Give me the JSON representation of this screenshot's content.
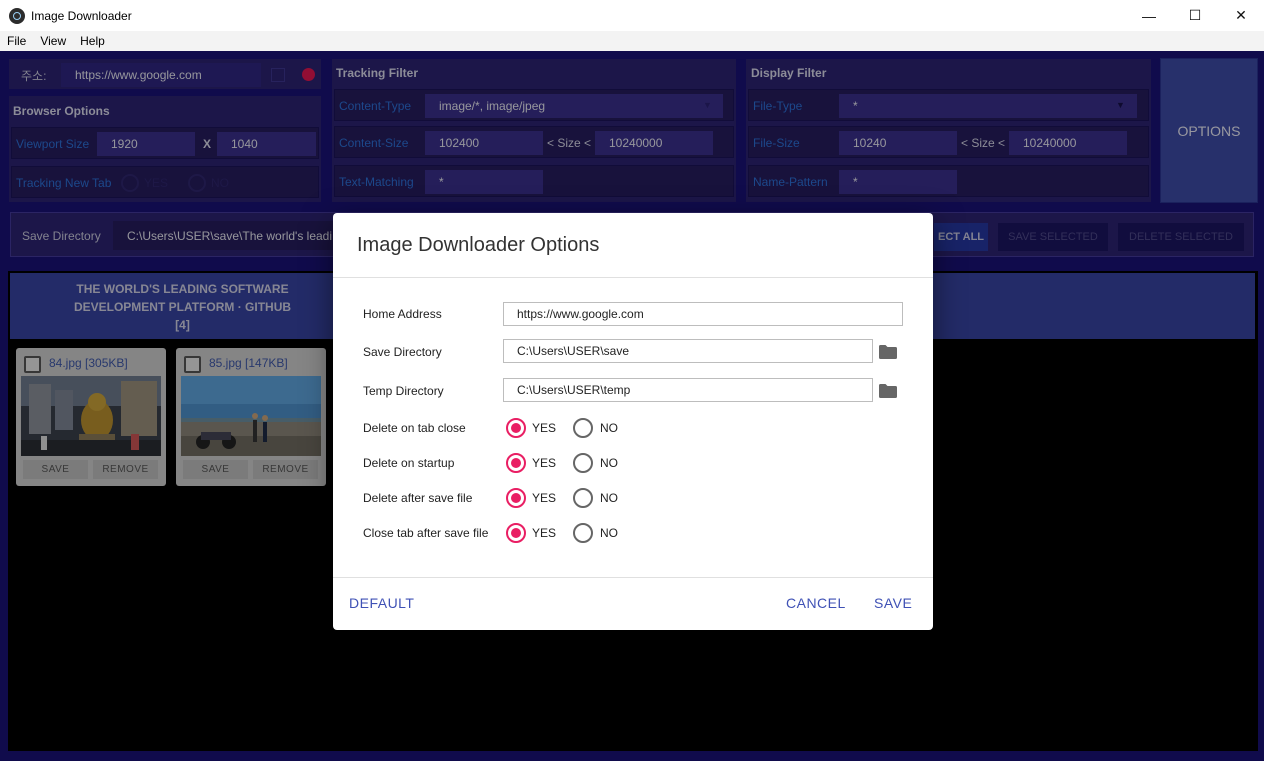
{
  "window": {
    "title": "Image Downloader",
    "minimize": "—",
    "maximize": "☐",
    "close": "✕"
  },
  "menu": [
    "File",
    "View",
    "Help"
  ],
  "address": {
    "label": "주소:",
    "value": "https://www.google.com"
  },
  "browser_options": {
    "title": "Browser Options",
    "viewport_label": "Viewport Size",
    "width": "1920",
    "x": "X",
    "height": "1040",
    "tracking_label": "Tracking New Tab",
    "yes": "YES",
    "no": "NO"
  },
  "tracking_filter": {
    "title": "Tracking Filter",
    "content_type_label": "Content-Type",
    "content_type_value": "image/*, image/jpeg",
    "content_size_label": "Content-Size",
    "size_min": "102400",
    "size_sep": "< Size <",
    "size_max": "10240000",
    "text_matching_label": "Text-Matching",
    "text_matching_value": "*"
  },
  "display_filter": {
    "title": "Display Filter",
    "file_type_label": "File-Type",
    "file_type_value": "*",
    "file_size_label": "File-Size",
    "size_min": "10240",
    "size_sep": "< Size <",
    "size_max": "10240000",
    "name_pattern_label": "Name-Pattern",
    "name_pattern_value": "*"
  },
  "options_button": "OPTIONS",
  "save_bar": {
    "label": "Save Directory",
    "value": "C:\\Users\\USER\\save\\The world's leadi",
    "select_all": "ECT ALL",
    "save_selected": "SAVE SELECTED",
    "delete_selected": "DELETE SELECTED"
  },
  "gallery": {
    "title_line1": "THE WORLD'S LEADING SOFTWARE",
    "title_line2": "DEVELOPMENT PLATFORM · GITHUB",
    "count": "[4]",
    "cards": [
      {
        "name": "84.jpg [305KB]",
        "save": "SAVE",
        "remove": "REMOVE"
      },
      {
        "name": "85.jpg [147KB]",
        "save": "SAVE",
        "remove": "REMOVE"
      }
    ]
  },
  "dialog": {
    "title": "Image Downloader Options",
    "home_label": "Home Address",
    "home_value": "https://www.google.com",
    "save_dir_label": "Save Directory",
    "save_dir_value": "C:\\Users\\USER\\save",
    "temp_dir_label": "Temp Directory",
    "temp_dir_value": "C:\\Users\\USER\\temp",
    "yes": "YES",
    "no": "NO",
    "toggles": [
      {
        "label": "Delete on tab close",
        "value": "YES"
      },
      {
        "label": "Delete on startup",
        "value": "YES"
      },
      {
        "label": "Delete after save file",
        "value": "YES"
      },
      {
        "label": "Close tab after save file",
        "value": "YES"
      }
    ],
    "default_btn": "DEFAULT",
    "cancel_btn": "CANCEL",
    "save_btn": "SAVE"
  },
  "colors": {
    "accent": "#3f51b5",
    "radio_checked": "#e91e63",
    "app_bg": "#1a1276",
    "panel_bg": "#2b2270"
  }
}
